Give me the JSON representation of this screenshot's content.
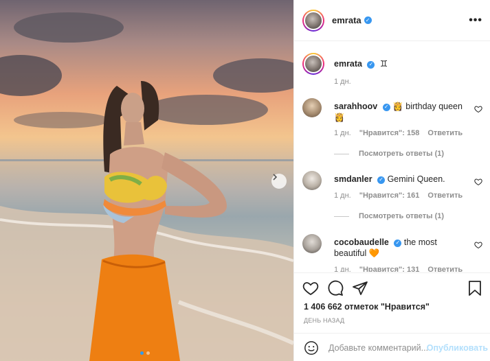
{
  "post": {
    "photo_alt": "",
    "slide_count": 2,
    "active_slide": 1
  },
  "header": {
    "username": "emrata",
    "verified_symbol": "✓",
    "more_label": "•••"
  },
  "caption": {
    "username": "emrata",
    "emoji": "♊",
    "time": "1 дн."
  },
  "comments": [
    {
      "username": "sarahhoov",
      "emoji": "👸",
      "text": "birthday queen",
      "emoji_after": "👸",
      "time": "1 дн.",
      "likes": "\"Нравится\": 158",
      "reply": "Ответить",
      "view_replies": "Посмотреть ответы (1)"
    },
    {
      "username": "smdanler",
      "text": "Gemini Queen.",
      "time": "1 дн.",
      "likes": "\"Нравится\": 161",
      "reply": "Ответить",
      "view_replies": "Посмотреть ответы (1)"
    },
    {
      "username": "cocobaudelle",
      "text": "the most beautiful",
      "emoji": "🧡",
      "time": "1 дн.",
      "likes": "\"Нравится\": 131",
      "reply": "Ответить"
    }
  ],
  "actions": {
    "likes_text": "1 406 662 отметок \"Нравится\"",
    "posted_ago": "ДЕНЬ НАЗАД",
    "comment_placeholder": "Добавьте комментарий...",
    "publish_label": "Опубликовать"
  },
  "icons": {
    "like": "heart-icon",
    "comment": "comment-icon",
    "share": "paper-plane-icon",
    "save": "bookmark-icon",
    "emoji": "smiley-icon",
    "more": "more-icon",
    "next": "chevron-right-icon"
  },
  "colors": {
    "accent": "#3897f0",
    "publish_disabled": "#b2dffc",
    "secondary_text": "#8e8e8e",
    "border": "#efefef"
  }
}
